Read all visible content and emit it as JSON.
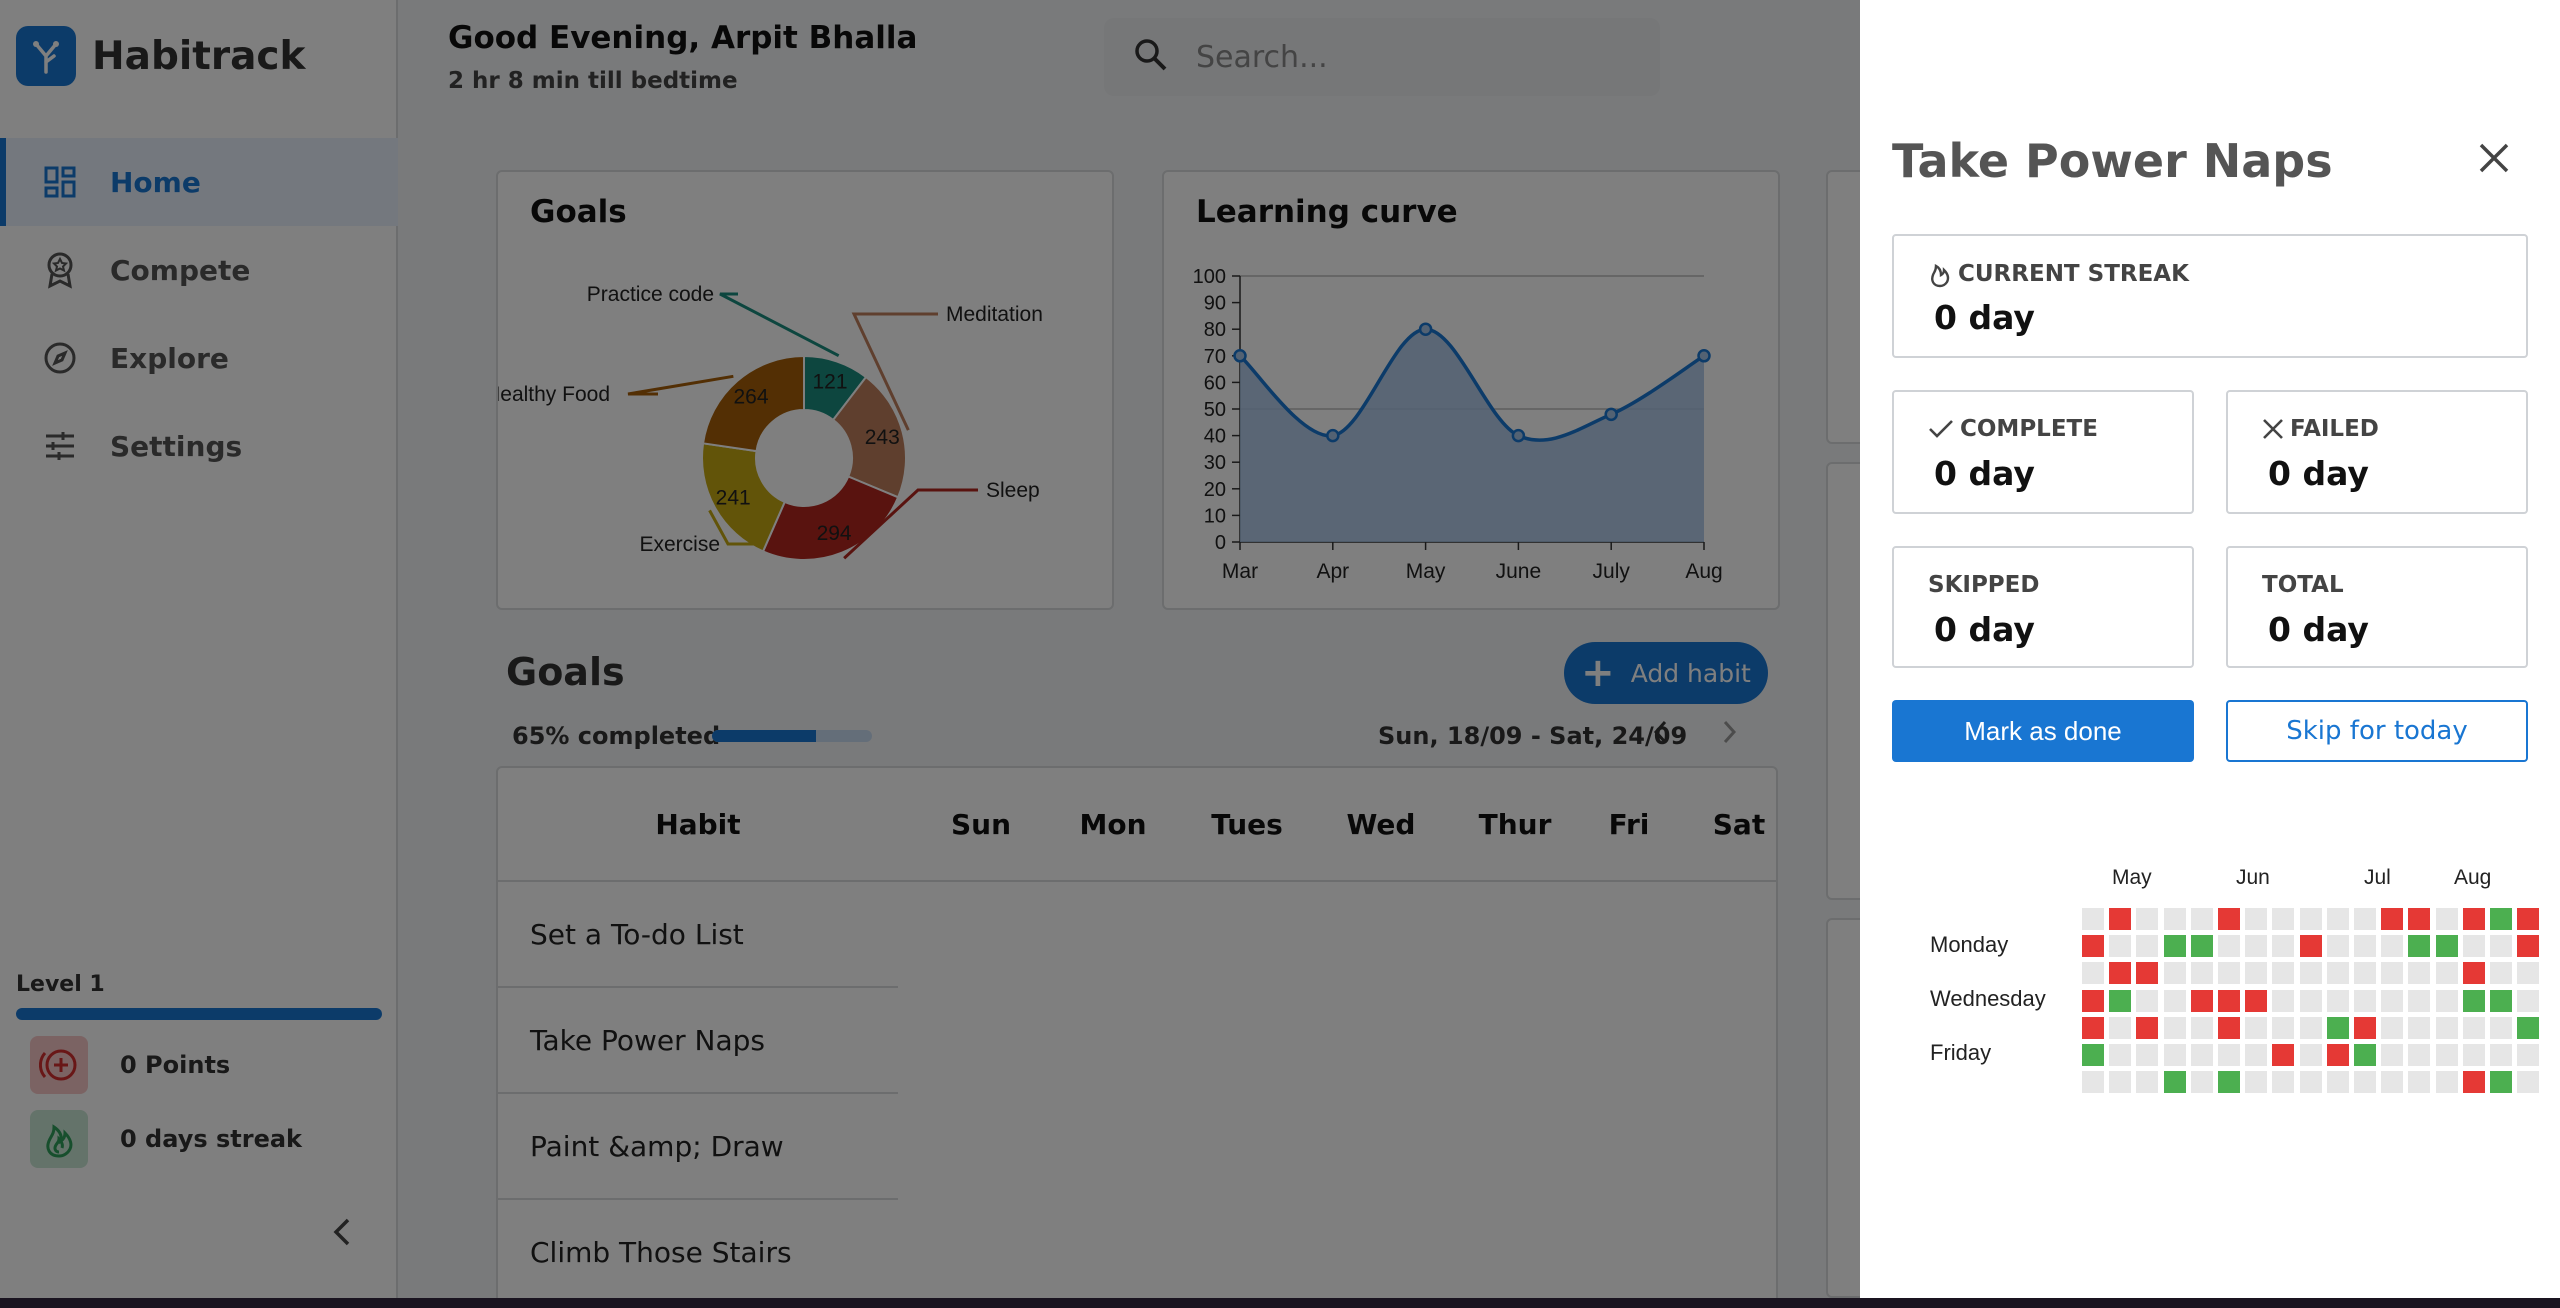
{
  "app": {
    "name": "Habitrack"
  },
  "sidebar": {
    "items": [
      {
        "label": "Home",
        "icon": "dashboard-icon",
        "active": true
      },
      {
        "label": "Compete",
        "icon": "award-icon",
        "active": false
      },
      {
        "label": "Explore",
        "icon": "compass-icon",
        "active": false
      },
      {
        "label": "Settings",
        "icon": "sliders-icon",
        "active": false
      }
    ],
    "level": "Level 1",
    "points": "0 Points",
    "streak": "0 days streak"
  },
  "header": {
    "greeting": "Good Evening, Arpit Bhalla",
    "subtitle": "2 hr 8 min till bedtime",
    "search_placeholder": "Search..."
  },
  "goals_chart": {
    "title": "Goals",
    "chart_data": {
      "type": "pie",
      "variant": "donut",
      "slices": [
        {
          "label": "Practice code",
          "value": 121,
          "color": "#1a8c7e"
        },
        {
          "label": "Meditation",
          "value": 243,
          "color": "#bf7e5c"
        },
        {
          "label": "Sleep",
          "value": 294,
          "color": "#b3261e"
        },
        {
          "label": "Exercise",
          "value": 241,
          "color": "#c5a813"
        },
        {
          "label": "Healthy Food",
          "value": 264,
          "color": "#a65e08"
        }
      ]
    }
  },
  "learning_chart": {
    "title": "Learning curve",
    "chart_data": {
      "type": "area",
      "categories": [
        "Mar",
        "Apr",
        "May",
        "June",
        "July",
        "Aug"
      ],
      "values": [
        70,
        40,
        80,
        40,
        48,
        70
      ],
      "ylim": [
        0,
        100
      ],
      "yticks": [
        0,
        10,
        20,
        30,
        40,
        50,
        60,
        70,
        80,
        90,
        100
      ],
      "color": "#1976d2"
    }
  },
  "goals_section": {
    "title": "Goals",
    "add_label": "Add habit",
    "progress_text": "65% completed",
    "progress": 0.65,
    "date_range": "Sun, 18/09 - Sat, 24/09"
  },
  "table": {
    "headers": [
      "Habit",
      "Sun",
      "Mon",
      "Tues",
      "Wed",
      "Thur",
      "Fri",
      "Sat"
    ],
    "rows": [
      "Set a To-do List",
      "Take Power Naps",
      "Paint &amp; Draw",
      "Climb Those Stairs"
    ]
  },
  "drawer": {
    "title": "Take Power Naps",
    "current_streak_label": "CURRENT STREAK",
    "current_streak_value": "0 day",
    "complete_label": "COMPLETE",
    "complete_value": "0 day",
    "failed_label": "FAILED",
    "failed_value": "0 day",
    "skipped_label": "SKIPPED",
    "skipped_value": "0 day",
    "total_label": "TOTAL",
    "total_value": "0 day",
    "done_label": "Mark as done",
    "skip_label": "Skip for today",
    "heatmap": {
      "months": [
        "May",
        "Jun",
        "Jul",
        "Aug"
      ],
      "day_labels": [
        "Monday",
        "Wednesday",
        "Friday"
      ],
      "colors": {
        "0": "#e6e6e6",
        "1": "#e53935",
        "2": "#4caf50"
      },
      "grid": [
        "01000100000110121",
        "10022000100022001",
        "01100000000000100",
        "12001110000000220",
        "10100100021000002",
        "20000001012000000",
        "00020200000000120"
      ]
    }
  }
}
